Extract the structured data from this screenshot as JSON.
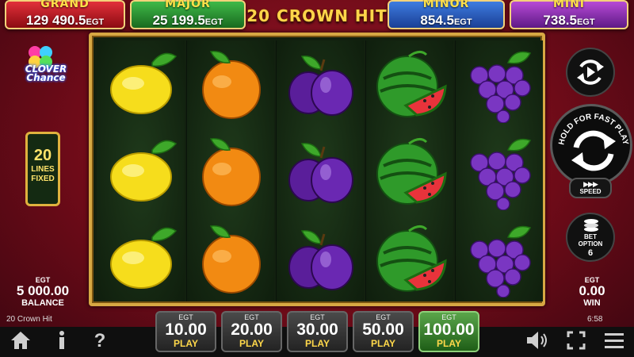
{
  "jackpots": {
    "grand": {
      "name": "GRAND",
      "value": "129 490.5",
      "currency": "EGT"
    },
    "major": {
      "name": "MAJOR",
      "value": "25 199.5",
      "currency": "EGT"
    },
    "minor": {
      "name": "MINOR",
      "value": "854.5",
      "currency": "EGT"
    },
    "mini": {
      "name": "MINI",
      "value": "738.5",
      "currency": "EGT"
    }
  },
  "game_title": "20 CROWN HIT",
  "feature_logo": {
    "line1": "CLOVER",
    "line2": "Chance"
  },
  "lines": {
    "count": "20",
    "label1": "LINES",
    "label2": "FIXED"
  },
  "reels": [
    [
      "lemon",
      "lemon",
      "lemon"
    ],
    [
      "orange",
      "orange",
      "orange"
    ],
    [
      "plum",
      "plum",
      "plum"
    ],
    [
      "watermelon",
      "watermelon",
      "watermelon"
    ],
    [
      "grapes",
      "grapes",
      "grapes"
    ]
  ],
  "controls": {
    "spin_label": "HOLD FOR FAST PLAY",
    "speed_label": "SPEED",
    "bet_option_label1": "BET",
    "bet_option_label2": "OPTION",
    "bet_option_value": "6"
  },
  "balance": {
    "currency": "EGT",
    "amount": "5 000.00",
    "label": "BALANCE"
  },
  "win": {
    "currency": "EGT",
    "amount": "0.00",
    "label": "WIN"
  },
  "bets": [
    {
      "currency": "EGT",
      "amount": "10.00",
      "label": "PLAY",
      "active": false
    },
    {
      "currency": "EGT",
      "amount": "20.00",
      "label": "PLAY",
      "active": false
    },
    {
      "currency": "EGT",
      "amount": "30.00",
      "label": "PLAY",
      "active": false
    },
    {
      "currency": "EGT",
      "amount": "50.00",
      "label": "PLAY",
      "active": false
    },
    {
      "currency": "EGT",
      "amount": "100.00",
      "label": "PLAY",
      "active": true
    }
  ],
  "footer": {
    "game_name": "20 Crown Hit",
    "clock": "6:58"
  },
  "icons": {
    "home": "home-icon",
    "info": "info-icon",
    "help": "help-icon",
    "sound": "speaker-icon",
    "fullscreen": "fullscreen-icon",
    "menu": "menu-icon"
  },
  "colors": {
    "background": "#8b1020",
    "reel_frame": "#d7a843",
    "reel_bg": "#12200f",
    "title": "#ffd54a",
    "active_bet": "#3d8a2f"
  }
}
